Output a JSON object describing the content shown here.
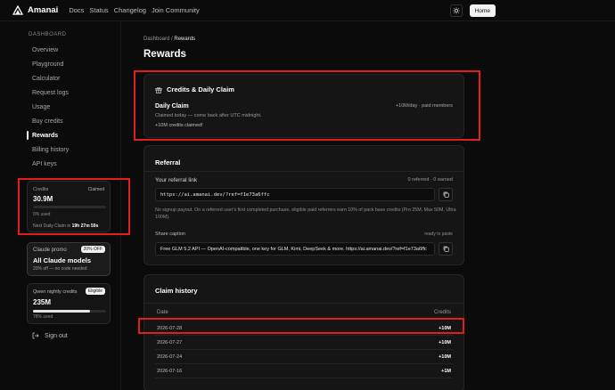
{
  "brand": {
    "name": "Amanai"
  },
  "nav": [
    "Docs",
    "Status",
    "Changelog",
    "Join Community"
  ],
  "top_right": {
    "home_label": "Home"
  },
  "sidebar": {
    "heading": "DASHBOARD",
    "items": [
      "Overview",
      "Playground",
      "Calculator",
      "Request logs",
      "Usage",
      "Buy credits",
      "Rewards",
      "Billing history",
      "API keys"
    ],
    "active": "Rewards",
    "credits_card": {
      "label": "Credits",
      "status": "Claimed",
      "value": "30.9M",
      "used_text": "0% used",
      "used_fraction": 0.0,
      "next_claim_prefix": "Next Daily Claim in",
      "next_claim_time": "19h 27m 59s"
    },
    "promo_card": {
      "label": "Claude promo",
      "badge": "20% OFF",
      "title": "All Claude models",
      "subtitle": "20% off — no code needed"
    },
    "qwen_card": {
      "label": "Qwen nightly credits",
      "badge": "Eligible",
      "value": "235M",
      "used_text": "78% used",
      "used_fraction": 0.78
    },
    "signout_label": "Sign out"
  },
  "breadcrumb": {
    "root": "Dashboard",
    "separator": "/",
    "current": "Rewards"
  },
  "page_title": "Rewards",
  "claim_panel": {
    "header": "Credits & Daily Claim",
    "title": "Daily Claim",
    "rate": "+10M/day · paid members",
    "description": "Claimed today — come back after UTC midnight.",
    "message": "+10M credits claimed!"
  },
  "referral_panel": {
    "title": "Referral",
    "link_label": "Your referral link",
    "count": "0 referred · 0 earned",
    "link": "https://ai.amanai.dev/?ref=f1e73a6ffc",
    "note": "No signup payout. On a referred user's first completed purchase, eligible paid referrers earn 10% of pack base credits (Pro 25M, Max 50M, Ultra 100M).",
    "caption_label": "Share caption",
    "caption_status": "ready to paste",
    "caption": "Free GLM 5.2 API — OpenAI-compatible, one key for GLM, Kimi, DeepSeek & more. https://ai.amanai.dev/?ref=f1e73a6ffc"
  },
  "history_panel": {
    "title": "Claim history",
    "columns": [
      "Date",
      "Credits"
    ],
    "rows": [
      {
        "date": "2026-07-28",
        "credits": "+10M"
      },
      {
        "date": "2026-07-27",
        "credits": "+10M"
      },
      {
        "date": "2026-07-24",
        "credits": "+10M"
      },
      {
        "date": "2026-07-16",
        "credits": "+1M"
      }
    ]
  },
  "colors": {
    "background": "#0b0b0b",
    "panel": "#151515",
    "highlight": "#e11d1d",
    "accent": "#f2f2f2"
  }
}
